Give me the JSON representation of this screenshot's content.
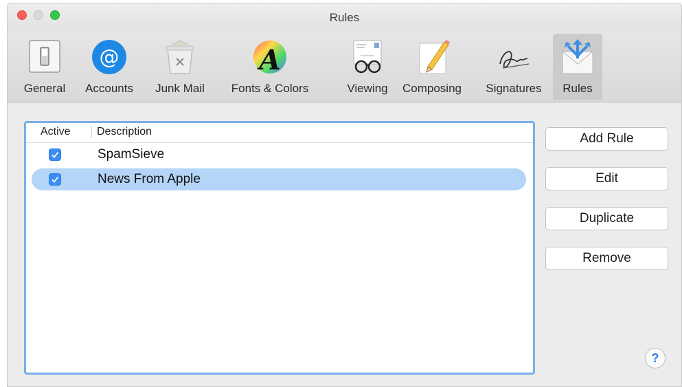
{
  "window": {
    "title": "Rules"
  },
  "toolbar": {
    "items": [
      {
        "label": "General",
        "icon": "switch-icon"
      },
      {
        "label": "Accounts",
        "icon": "at-sign-icon"
      },
      {
        "label": "Junk Mail",
        "icon": "trash-bin-icon"
      },
      {
        "label": "Fonts & Colors",
        "icon": "font-color-icon"
      },
      {
        "label": "Viewing",
        "icon": "glasses-envelope-icon"
      },
      {
        "label": "Composing",
        "icon": "pencil-paper-icon"
      },
      {
        "label": "Signatures",
        "icon": "signature-icon"
      },
      {
        "label": "Rules",
        "icon": "rules-envelope-icon",
        "selected": true
      }
    ]
  },
  "rules_list": {
    "headers": {
      "active": "Active",
      "description": "Description"
    },
    "rows": [
      {
        "active": true,
        "description": "SpamSieve",
        "selected": false
      },
      {
        "active": true,
        "description": "News From Apple",
        "selected": true
      }
    ]
  },
  "buttons": {
    "add_rule": "Add Rule",
    "edit": "Edit",
    "duplicate": "Duplicate",
    "remove": "Remove",
    "help": "?"
  },
  "colors": {
    "selection": "#b4d5f8",
    "list_focus_ring": "#7aaee8",
    "checkbox": "#3c8ef5",
    "accounts_blue": "#1e88e5"
  }
}
